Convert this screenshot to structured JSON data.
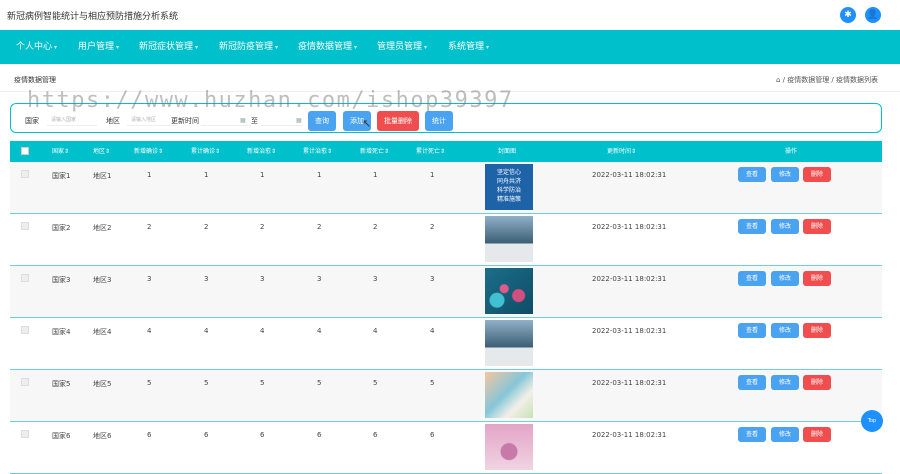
{
  "app": {
    "title": "新冠病例智能统计与相应预防措施分析系统",
    "icons": {
      "share": "✱",
      "user": "👤"
    }
  },
  "nav": {
    "items": [
      {
        "label": "个人中心"
      },
      {
        "label": "用户管理"
      },
      {
        "label": "新冠症状管理"
      },
      {
        "label": "新冠防疫管理"
      },
      {
        "label": "疫情数据管理"
      },
      {
        "label": "管理员管理"
      },
      {
        "label": "系统管理"
      }
    ]
  },
  "page": {
    "title": "疫情数据管理",
    "breadcrumb": "⌂ / 疫情数据管理 / 疫情数据列表"
  },
  "search": {
    "country_label": "国家",
    "country_placeholder": "请输入国家",
    "region_label": "地区",
    "region_placeholder": "请输入地区",
    "time_label": "更新时间",
    "to_label": "至",
    "query_button": "查询",
    "add_button": "添加",
    "batch_delete_button": "批量删除",
    "stats_button": "统计"
  },
  "watermark": "https://www.huzhan.com/ishop39397",
  "table": {
    "headers": [
      "国家⇕",
      "地区⇕",
      "新增确诊⇕",
      "累计确诊⇕",
      "新增治愈⇕",
      "累计治愈⇕",
      "新增死亡⇕",
      "累计死亡⇕",
      "封面图",
      "更新时间⇕",
      "操作"
    ],
    "rows": [
      {
        "country": "国家1",
        "region": "地区1",
        "c1": "1",
        "c2": "1",
        "c3": "1",
        "c4": "1",
        "c5": "1",
        "c6": "1",
        "time": "2022-03-11 18:02:31",
        "thumb_text": "坚定信心\n同舟共济\n科学防治\n精准施策"
      },
      {
        "country": "国家2",
        "region": "地区2",
        "c1": "2",
        "c2": "2",
        "c3": "2",
        "c4": "2",
        "c5": "2",
        "c6": "2",
        "time": "2022-03-11 18:02:31"
      },
      {
        "country": "国家3",
        "region": "地区3",
        "c1": "3",
        "c2": "3",
        "c3": "3",
        "c4": "3",
        "c5": "3",
        "c6": "3",
        "time": "2022-03-11 18:02:31"
      },
      {
        "country": "国家4",
        "region": "地区4",
        "c1": "4",
        "c2": "4",
        "c3": "4",
        "c4": "4",
        "c5": "4",
        "c6": "4",
        "time": "2022-03-11 18:02:31"
      },
      {
        "country": "国家5",
        "region": "地区5",
        "c1": "5",
        "c2": "5",
        "c3": "5",
        "c4": "5",
        "c5": "5",
        "c6": "5",
        "time": "2022-03-11 18:02:31"
      },
      {
        "country": "国家6",
        "region": "地区6",
        "c1": "6",
        "c2": "6",
        "c3": "6",
        "c4": "6",
        "c5": "6",
        "c6": "6",
        "time": "2022-03-11 18:02:31"
      }
    ],
    "actions": {
      "view": "查看",
      "edit": "修改",
      "delete": "删除"
    }
  },
  "fab": {
    "label": "Top"
  },
  "colors": {
    "primary": "#00c1cb",
    "blue": "#4aa3f0",
    "red": "#f04e4e",
    "orange": "#f5a623",
    "fab": "#1e90ff"
  }
}
